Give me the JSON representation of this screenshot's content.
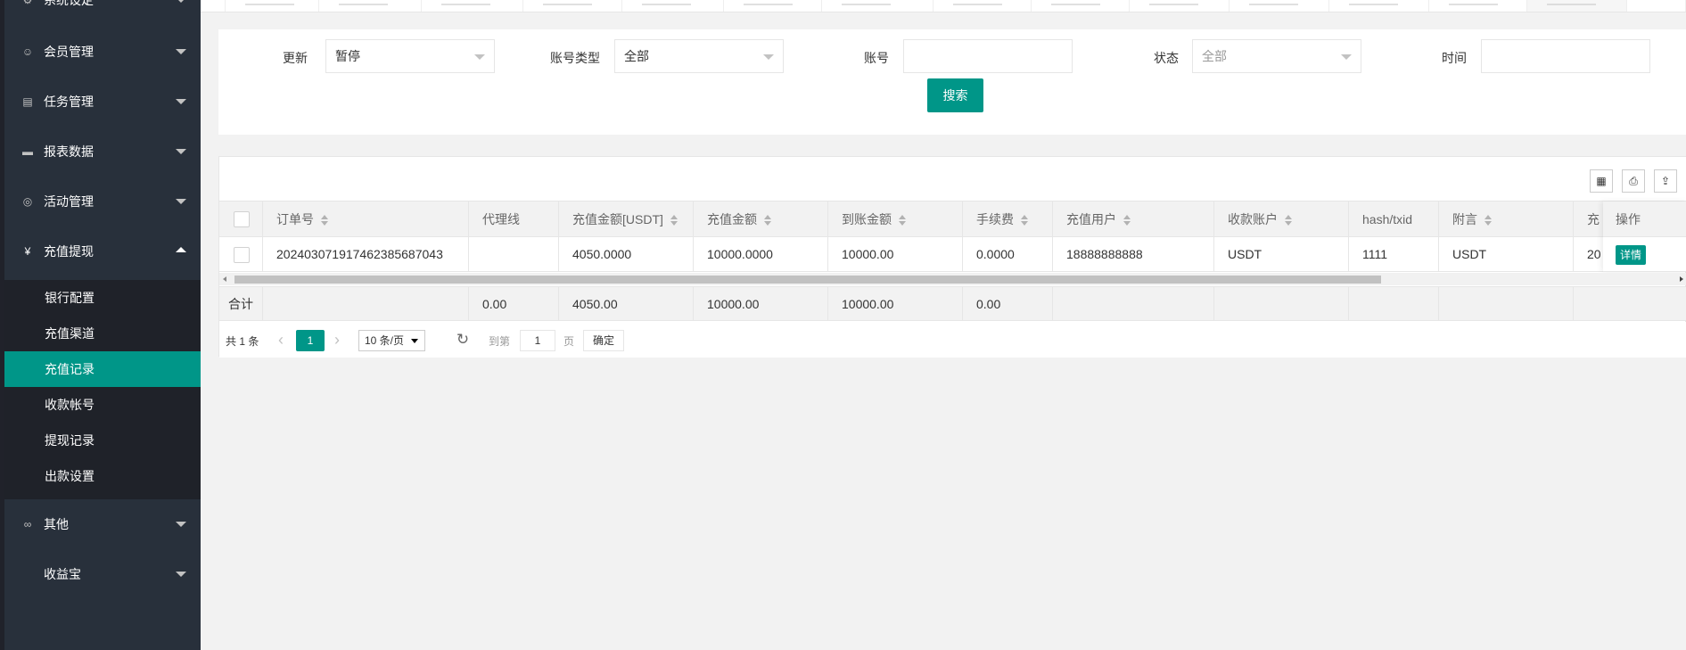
{
  "sidebar": {
    "menu": [
      {
        "label": "系统设定",
        "icon": "gear-icon",
        "glyph": "⚙"
      },
      {
        "label": "会员管理",
        "icon": "user-icon",
        "glyph": "☺"
      },
      {
        "label": "任务管理",
        "icon": "document-icon",
        "glyph": "▤"
      },
      {
        "label": "报表数据",
        "icon": "monitor-icon",
        "glyph": "▬"
      },
      {
        "label": "活动管理",
        "icon": "gamepad-icon",
        "glyph": "◎"
      },
      {
        "label": "充值提现",
        "icon": "yen-icon",
        "glyph": "¥"
      },
      {
        "label": "其他",
        "icon": "link-icon",
        "glyph": "∞"
      },
      {
        "label": "收益宝",
        "icon": "",
        "glyph": ""
      }
    ],
    "submenu": [
      "银行配置",
      "充值渠道",
      "充值记录",
      "收款帐号",
      "提现记录",
      "出款设置"
    ]
  },
  "search": {
    "update_label": "更新",
    "update_value": "暂停",
    "account_type_label": "账号类型",
    "account_type_value": "全部",
    "account_label": "账号",
    "account_value": "",
    "status_label": "状态",
    "status_value": "全部",
    "time_label": "时间",
    "time_value": "",
    "search_button": "搜索"
  },
  "toolbar": {
    "columns_icon": "columns-icon",
    "print_icon": "print-icon",
    "export_icon": "export-icon",
    "columns_glyph": "▦",
    "print_glyph": "⎙",
    "export_glyph": "⇪"
  },
  "table": {
    "headers": [
      "订单号",
      "代理线",
      "充值金额[USDT]",
      "充值金额",
      "到账金额",
      "手续费",
      "充值用户",
      "收款账户",
      "hash/txid",
      "附言",
      "充"
    ],
    "row": [
      "20240307191746238568704З",
      "",
      "4050.0000",
      "10000.0000",
      "10000.00",
      "0.0000",
      "18888888888",
      "USDT",
      "1111",
      "USDT",
      "20"
    ],
    "action_header": "操作",
    "action_button": "详情",
    "totals_label": "合计",
    "totals": [
      "",
      "0.00",
      "4050.00",
      "10000.00",
      "10000.00",
      "0.00"
    ]
  },
  "pager": {
    "total": "共 1 条",
    "prev": "‹",
    "current_page": "1",
    "next": "›",
    "page_size": "10 条/页",
    "refresh": "↻",
    "goto_label": "到第",
    "goto_value": "1",
    "page_unit": "页",
    "confirm": "确定"
  },
  "colors": {
    "accent": "#009688",
    "sidebar_bg": "#28303b",
    "submenu_bg": "#1f2229"
  }
}
